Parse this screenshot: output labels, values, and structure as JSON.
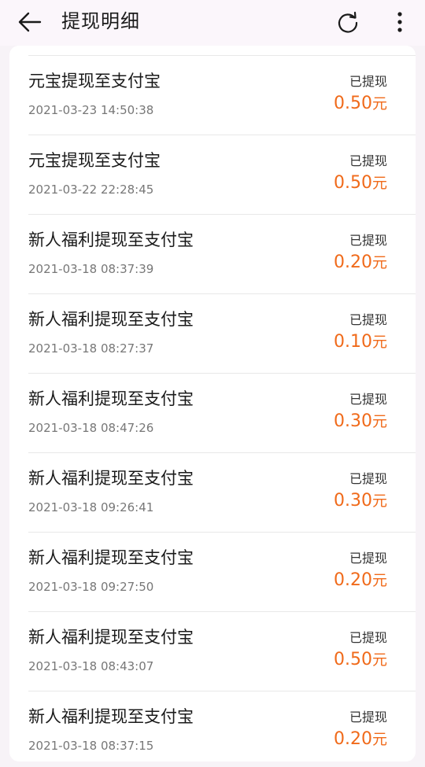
{
  "header": {
    "title": "提现明细",
    "icons": {
      "back": "arrow-left-icon",
      "refresh": "refresh-icon",
      "more": "more-vertical-icon"
    }
  },
  "colors": {
    "amount": "#f06a1a",
    "header_bg": "#fbf6fb",
    "page_bg": "#f7f3f7"
  },
  "records": [
    {
      "title": "元宝提现至支付宝",
      "time": "2021-03-23 14:50:38",
      "status": "已提现",
      "amount": "0.50",
      "unit": "元"
    },
    {
      "title": "元宝提现至支付宝",
      "time": "2021-03-22 22:28:45",
      "status": "已提现",
      "amount": "0.50",
      "unit": "元"
    },
    {
      "title": "新人福利提现至支付宝",
      "time": "2021-03-18 08:37:39",
      "status": "已提现",
      "amount": "0.20",
      "unit": "元"
    },
    {
      "title": "新人福利提现至支付宝",
      "time": "2021-03-18 08:27:37",
      "status": "已提现",
      "amount": "0.10",
      "unit": "元"
    },
    {
      "title": "新人福利提现至支付宝",
      "time": "2021-03-18 08:47:26",
      "status": "已提现",
      "amount": "0.30",
      "unit": "元"
    },
    {
      "title": "新人福利提现至支付宝",
      "time": "2021-03-18 09:26:41",
      "status": "已提现",
      "amount": "0.30",
      "unit": "元"
    },
    {
      "title": "新人福利提现至支付宝",
      "time": "2021-03-18 09:27:50",
      "status": "已提现",
      "amount": "0.20",
      "unit": "元"
    },
    {
      "title": "新人福利提现至支付宝",
      "time": "2021-03-18 08:43:07",
      "status": "已提现",
      "amount": "0.50",
      "unit": "元"
    },
    {
      "title": "新人福利提现至支付宝",
      "time": "2021-03-18 08:37:15",
      "status": "已提现",
      "amount": "0.20",
      "unit": "元"
    }
  ]
}
